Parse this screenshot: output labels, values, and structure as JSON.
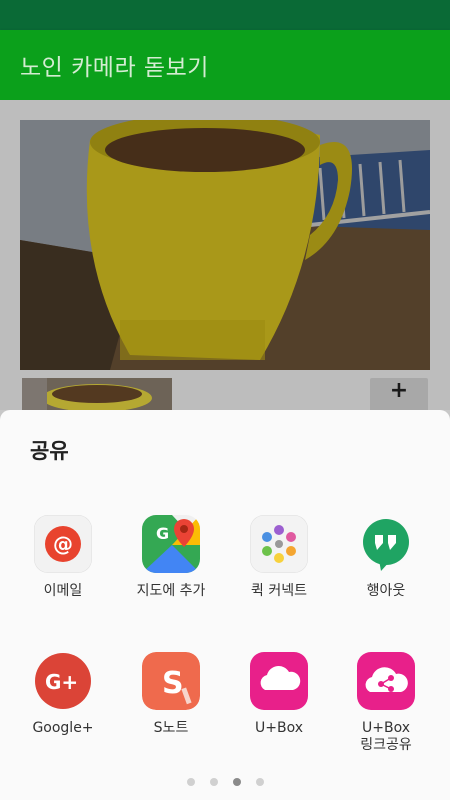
{
  "app_title": "노인 카메라 돋보기",
  "zoom_button": "+",
  "share": {
    "title": "공유",
    "apps": [
      {
        "label": "이메일",
        "icon": "email-icon"
      },
      {
        "label": "지도에 추가",
        "icon": "maps-icon"
      },
      {
        "label": "퀵 커넥트",
        "icon": "quick-connect-icon"
      },
      {
        "label": "행아웃",
        "icon": "hangouts-icon"
      },
      {
        "label": "Google+",
        "icon": "google-plus-icon"
      },
      {
        "label": "S노트",
        "icon": "s-note-icon"
      },
      {
        "label": "U+Box",
        "icon": "uplus-box-icon"
      },
      {
        "label": "U+Box\n링크공유",
        "icon": "uplus-box-link-icon"
      }
    ],
    "page_count": 4,
    "current_page": 3
  },
  "colors": {
    "status_bar": "#0a6a36",
    "app_bar": "#0ba01b",
    "sheet": "#fafafa"
  }
}
